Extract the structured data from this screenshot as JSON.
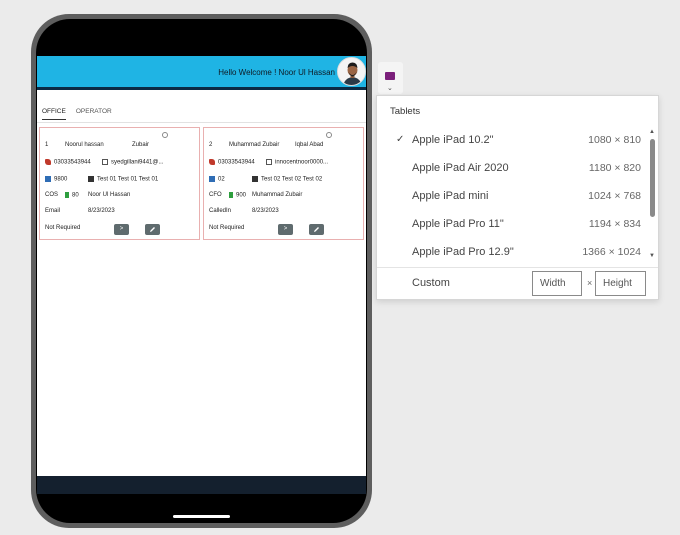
{
  "app": {
    "welcome": "Hello Welcome !  Noor Ul Hassan",
    "tabs": [
      "OFFICE",
      "OPERATOR"
    ]
  },
  "cards": [
    {
      "index": "1",
      "name": "Noorul hassan",
      "extra": "Zubair",
      "phone": "03033543944",
      "email": "syedgillani9441@...",
      "code": "9800",
      "test": "Test 01 Test 01 Test 01",
      "role": "COS",
      "count": "80",
      "person": "Noor Ul Hassan",
      "channel": "Email",
      "date": "8/23/2023",
      "status": "Not Required",
      "go_label": ">"
    },
    {
      "index": "2",
      "name": "Muhammad Zubair",
      "extra": "Iqbal Abad",
      "phone": "03033543944",
      "email": "innocentnoor0000...",
      "code": "02",
      "test": "Test 02 Test 02 Test 02",
      "role": "CFO",
      "count": "900",
      "person": "Muhammad Zubair",
      "channel": "CalledIn",
      "date": "8/23/2023",
      "status": "Not Required",
      "go_label": ">"
    }
  ],
  "dropdown": {
    "title": "Tablets",
    "options": [
      {
        "name": "Apple iPad 10.2\"",
        "size": "1080 × 810",
        "selected": true
      },
      {
        "name": "Apple iPad Air 2020",
        "size": "1180 × 820",
        "selected": false
      },
      {
        "name": "Apple iPad mini",
        "size": "1024 × 768",
        "selected": false
      },
      {
        "name": "Apple iPad Pro 11\"",
        "size": "1194 × 834",
        "selected": false
      },
      {
        "name": "Apple iPad Pro 12.9\"",
        "size": "1366 × 1024",
        "selected": false
      }
    ],
    "check_glyph": "✓",
    "custom_label": "Custom",
    "width_placeholder": "Width",
    "height_placeholder": "Height",
    "times": "×"
  },
  "colors": {
    "header": "#1fb4e4",
    "card_border": "#e9b0b0",
    "device_frame": "#5e5e5e"
  }
}
